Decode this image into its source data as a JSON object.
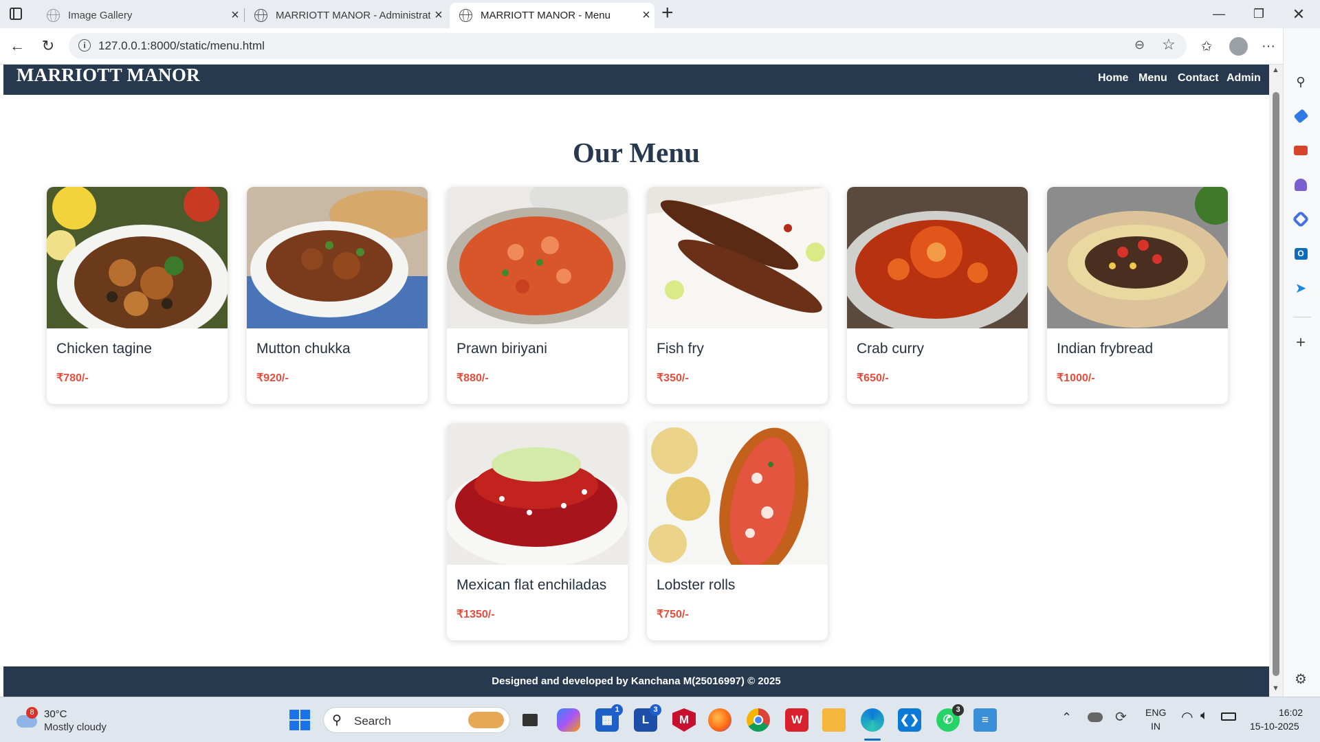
{
  "browser": {
    "tabs": [
      {
        "title": "Image Gallery",
        "active": false
      },
      {
        "title": "MARRIOTT MANOR - Administrat",
        "active": false
      },
      {
        "title": "MARRIOTT MANOR - Menu",
        "active": true
      }
    ],
    "new_tab": "+",
    "url": "127.0.0.1:8000/static/menu.html"
  },
  "site": {
    "brand": "MARRIOTT MANOR",
    "nav": [
      "Home",
      "Menu",
      "Contact",
      "Admin"
    ],
    "heading": "Our Menu",
    "footer": "Designed and developed by Kanchana M(25016997) © 2025"
  },
  "menu_items": [
    {
      "name": "Chicken tagine",
      "price": "₹780/-"
    },
    {
      "name": "Mutton chukka",
      "price": "₹920/-"
    },
    {
      "name": "Prawn biriyani",
      "price": "₹880/-"
    },
    {
      "name": "Fish fry",
      "price": "₹350/-"
    },
    {
      "name": "Crab curry",
      "price": "₹650/-"
    },
    {
      "name": "Indian frybread",
      "price": "₹1000/-"
    },
    {
      "name": "Mexican flat enchiladas",
      "price": "₹1350/-"
    },
    {
      "name": "Lobster rolls",
      "price": "₹750/-"
    }
  ],
  "taskbar": {
    "weather_temp": "30°C",
    "weather_desc": "Mostly cloudy",
    "weather_badge": "8",
    "search": "Search",
    "lang_top": "ENG",
    "lang_bottom": "IN",
    "time": "16:02",
    "date": "15-10-2025",
    "badges": {
      "store": "1",
      "l_app": "3",
      "whatsapp": "3"
    }
  },
  "colors": {
    "nav": "#26394e",
    "price": "#e74c3c",
    "heading": "#26394e"
  }
}
